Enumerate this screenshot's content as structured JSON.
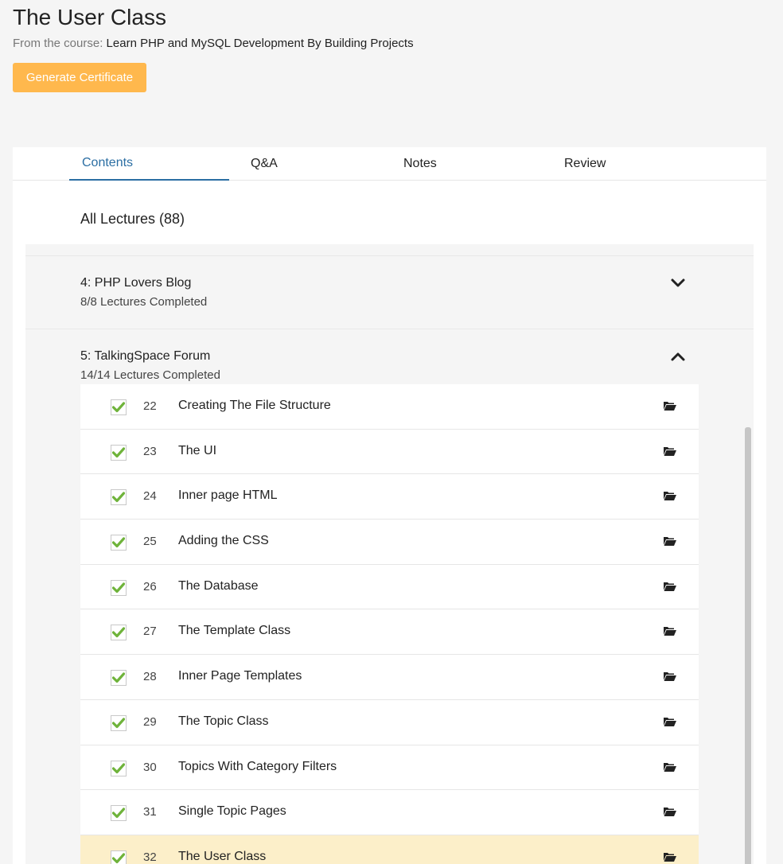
{
  "header": {
    "title": "The User Class",
    "course_prefix": "From the course:",
    "course_name": "Learn PHP and MySQL Development By Building Projects",
    "certificate_button": "Generate Certificate"
  },
  "tabs": [
    {
      "label": "Contents",
      "active": true
    },
    {
      "label": "Q&A",
      "active": false
    },
    {
      "label": "Notes",
      "active": false
    },
    {
      "label": "Review",
      "active": false
    }
  ],
  "all_lectures_label": "All Lectures (88)",
  "sections": [
    {
      "title": "4: PHP Lovers Blog",
      "progress": "8/8 Lectures Completed",
      "expanded": false,
      "icon": "chevron-down-icon"
    },
    {
      "title": "5: TalkingSpace Forum",
      "progress": "14/14 Lectures Completed",
      "expanded": true,
      "icon": "chevron-up-icon"
    }
  ],
  "lectures": [
    {
      "num": "22",
      "title": "Creating The File Structure",
      "completed": true,
      "current": false
    },
    {
      "num": "23",
      "title": "The UI",
      "completed": true,
      "current": false
    },
    {
      "num": "24",
      "title": "Inner page HTML",
      "completed": true,
      "current": false
    },
    {
      "num": "25",
      "title": "Adding the CSS",
      "completed": true,
      "current": false
    },
    {
      "num": "26",
      "title": "The Database",
      "completed": true,
      "current": false
    },
    {
      "num": "27",
      "title": "The Template Class",
      "completed": true,
      "current": false
    },
    {
      "num": "28",
      "title": "Inner Page Templates",
      "completed": true,
      "current": false
    },
    {
      "num": "29",
      "title": "The Topic Class",
      "completed": true,
      "current": false
    },
    {
      "num": "30",
      "title": "Topics With Category Filters",
      "completed": true,
      "current": false
    },
    {
      "num": "31",
      "title": "Single Topic Pages",
      "completed": true,
      "current": false
    },
    {
      "num": "32",
      "title": "The User Class",
      "completed": true,
      "current": true
    }
  ],
  "colors": {
    "accent_blue": "#2b6ea3",
    "certificate_orange": "#ffb84d",
    "check_green": "#6fb33b",
    "current_highlight": "#fcefc9"
  }
}
